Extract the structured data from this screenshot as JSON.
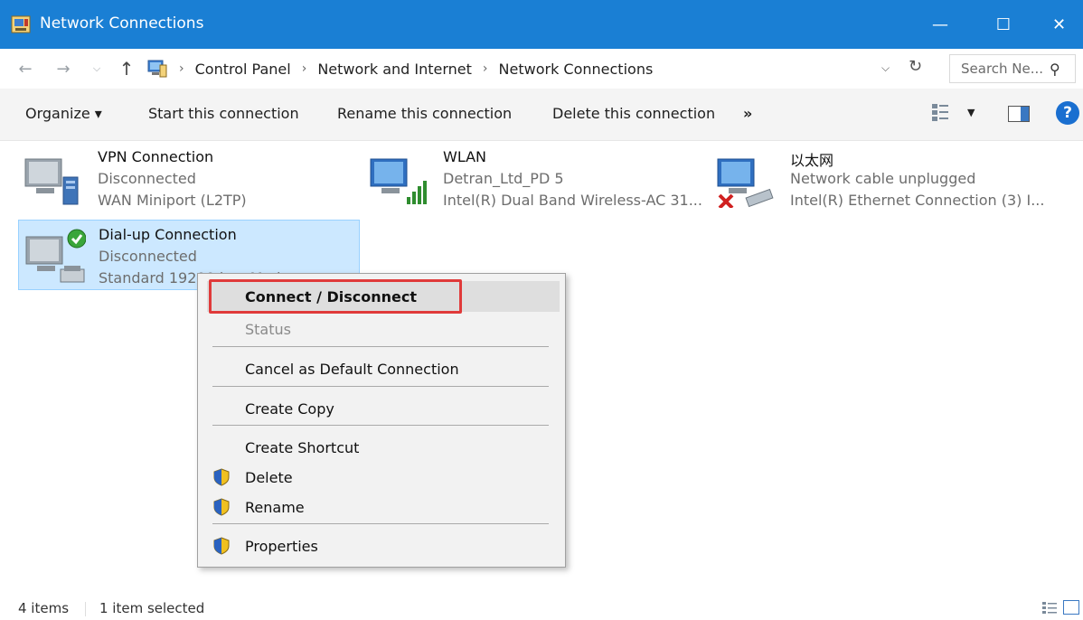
{
  "window": {
    "title": "Network Connections",
    "controls": {
      "minimize": "—",
      "maximize": "☐",
      "close": "✕"
    }
  },
  "nav": {
    "back_icon": "←",
    "forward_icon": "→",
    "recent_icon": "⌵",
    "up_icon": "↑",
    "breadcrumb": [
      "Control Panel",
      "Network and Internet",
      "Network Connections"
    ],
    "separator": "›",
    "dropdown_icon": "⌵",
    "refresh_icon": "↻",
    "search_placeholder": "Search Ne...",
    "search_icon": "⚲"
  },
  "commands": {
    "organize": "Organize ▾",
    "start": "Start this connection",
    "rename": "Rename this connection",
    "delete": "Delete this connection",
    "more": "»",
    "view_dropdown": "▼",
    "help": "?"
  },
  "items": [
    {
      "name": "VPN Connection",
      "status": "Disconnected",
      "device": "WAN Miniport (L2TP)"
    },
    {
      "name": "WLAN",
      "status": "Detran_Ltd_PD  5",
      "device": "Intel(R) Dual Band Wireless-AC 31..."
    },
    {
      "name": "以太网",
      "status": "Network cable unplugged",
      "device": "Intel(R) Ethernet Connection (3) I..."
    },
    {
      "name": "Dial-up Connection",
      "status": "Disconnected",
      "device": "Standard 19200 bps Modem"
    }
  ],
  "context_menu": {
    "connect": "Connect / Disconnect",
    "status": "Status",
    "cancel_default": "Cancel as Default Connection",
    "create_copy": "Create Copy",
    "create_shortcut": "Create Shortcut",
    "delete": "Delete",
    "rename": "Rename",
    "properties": "Properties"
  },
  "statusbar": {
    "count": "4 items",
    "selected": "1 item selected"
  },
  "colors": {
    "titlebar": "#1a7fd4",
    "selection": "#cce8ff",
    "highlight_box": "#e03a3a"
  }
}
